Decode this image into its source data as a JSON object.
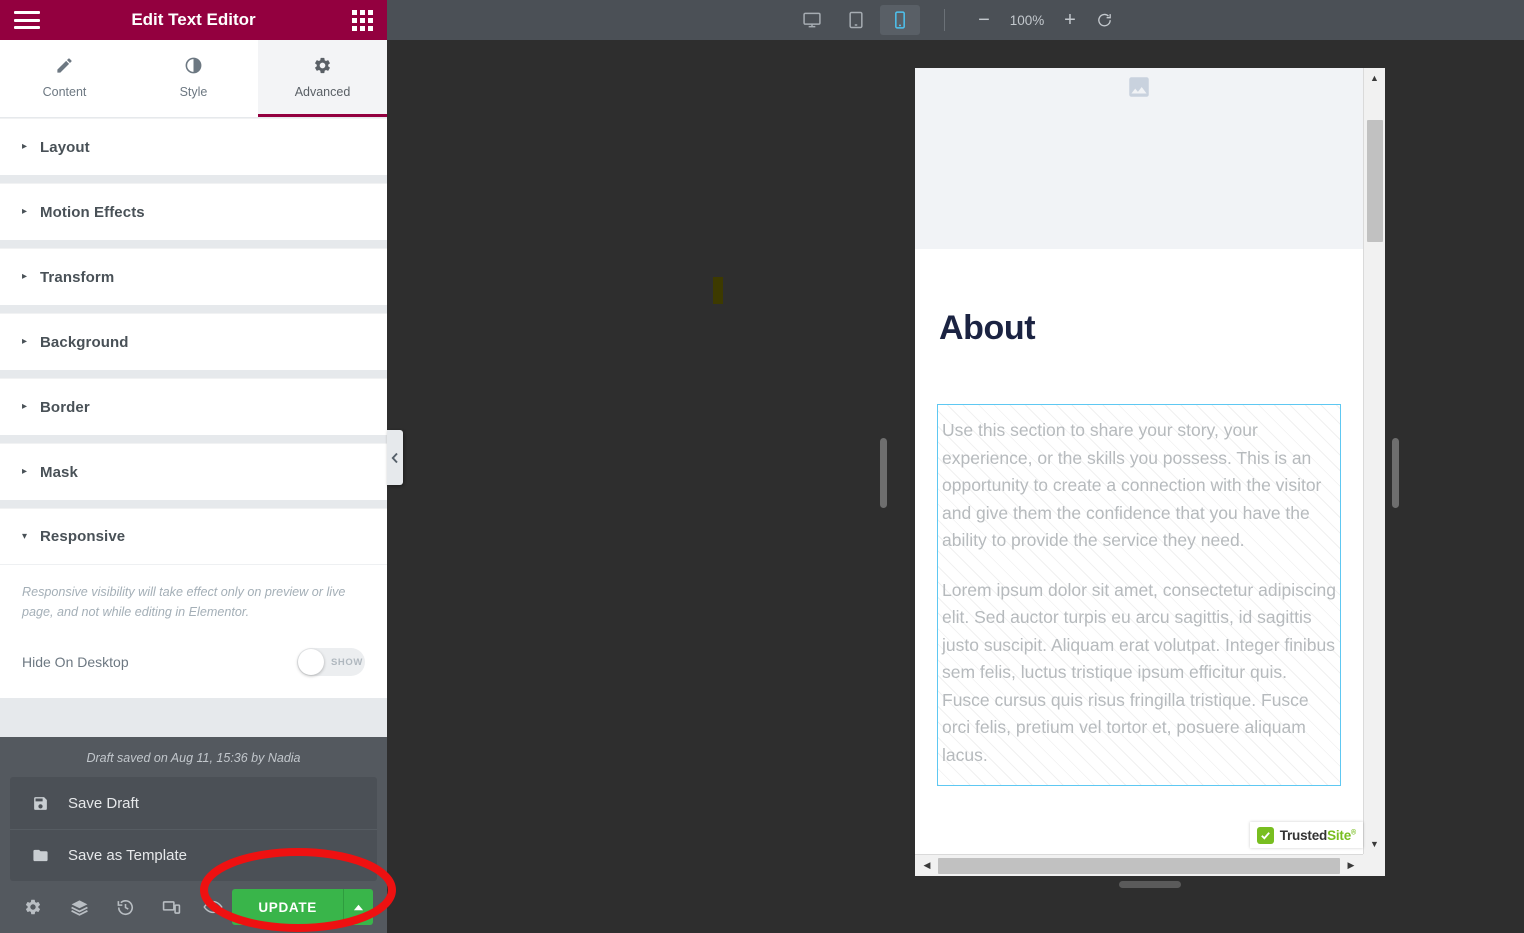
{
  "panel": {
    "header": {
      "title": "Edit Text Editor",
      "menu_icon": "hamburger-icon",
      "apps_icon": "apps-grid-icon"
    },
    "tabs": [
      {
        "label": "Content",
        "icon": "pencil-icon",
        "active": false
      },
      {
        "label": "Style",
        "icon": "contrast-circle-icon",
        "active": false
      },
      {
        "label": "Advanced",
        "icon": "gear-icon",
        "active": true
      }
    ],
    "sections": [
      {
        "label": "Layout",
        "open": false
      },
      {
        "label": "Motion Effects",
        "open": false
      },
      {
        "label": "Transform",
        "open": false
      },
      {
        "label": "Background",
        "open": false
      },
      {
        "label": "Border",
        "open": false
      },
      {
        "label": "Mask",
        "open": false
      },
      {
        "label": "Responsive",
        "open": true
      }
    ],
    "responsive": {
      "hint": "Responsive visibility will take effect only on preview or live page, and not while editing in Elementor.",
      "control_label": "Hide On Desktop",
      "toggle_state": "SHOW"
    },
    "footer": {
      "draft_note": "Draft saved on Aug 11, 15:36 by Nadia",
      "save_draft": "Save Draft",
      "save_as_template": "Save as Template",
      "update_label": "UPDATE",
      "update_color": "#39b54a",
      "tools": [
        {
          "name": "settings",
          "icon": "gear-icon"
        },
        {
          "name": "navigator",
          "icon": "layers-icon"
        },
        {
          "name": "history",
          "icon": "history-clock-icon"
        },
        {
          "name": "responsive-mode",
          "icon": "responsive-device-icon"
        }
      ],
      "preview_icon": "eye-icon"
    },
    "collapse_handle_icon": "chevron-left-icon",
    "accent_color": "#93003f"
  },
  "topbar": {
    "devices": [
      {
        "name": "desktop",
        "icon": "desktop-icon",
        "active": false
      },
      {
        "name": "tablet",
        "icon": "tablet-icon",
        "active": false
      },
      {
        "name": "mobile",
        "icon": "mobile-icon",
        "active": true
      }
    ],
    "zoom_out_icon": "minus-icon",
    "zoom_level": "100%",
    "zoom_in_icon": "plus-icon",
    "reset_icon": "reset-arrow-icon",
    "active_device_color": "#4ec3f0"
  },
  "preview": {
    "hero_placeholder_icon": "image-placeholder-icon",
    "heading": "About",
    "paragraphs": [
      "Use this section to share your story, your experience, or the skills you possess. This is an opportunity to create a connection with the visitor and give them the confidence that you have the ability to provide the service they need.",
      "Lorem ipsum dolor sit amet, consectetur adipiscing elit. Sed auctor turpis eu arcu sagittis, id sagittis justo suscipit. Aliquam erat volutpat. Integer finibus sem felis, luctus tristique ipsum efficitur quis. Fusce cursus quis risus fringilla tristique. Fusce orci felis, pretium vel tortor et, posuere aliquam lacus."
    ],
    "selected_widget_outline_color": "#5ec8f2",
    "scroll": {
      "v_up_icon": "triangle-up-icon",
      "v_down_icon": "triangle-down-icon",
      "h_left_icon": "triangle-left-icon",
      "h_right_icon": "triangle-right-icon"
    },
    "trusted_badge": {
      "part_a": "Trusted",
      "part_b": "Site",
      "registered": "®",
      "check_icon": "check-icon"
    }
  },
  "annotation": {
    "shape": "red-ellipse-highlight",
    "color": "#ee1111"
  }
}
